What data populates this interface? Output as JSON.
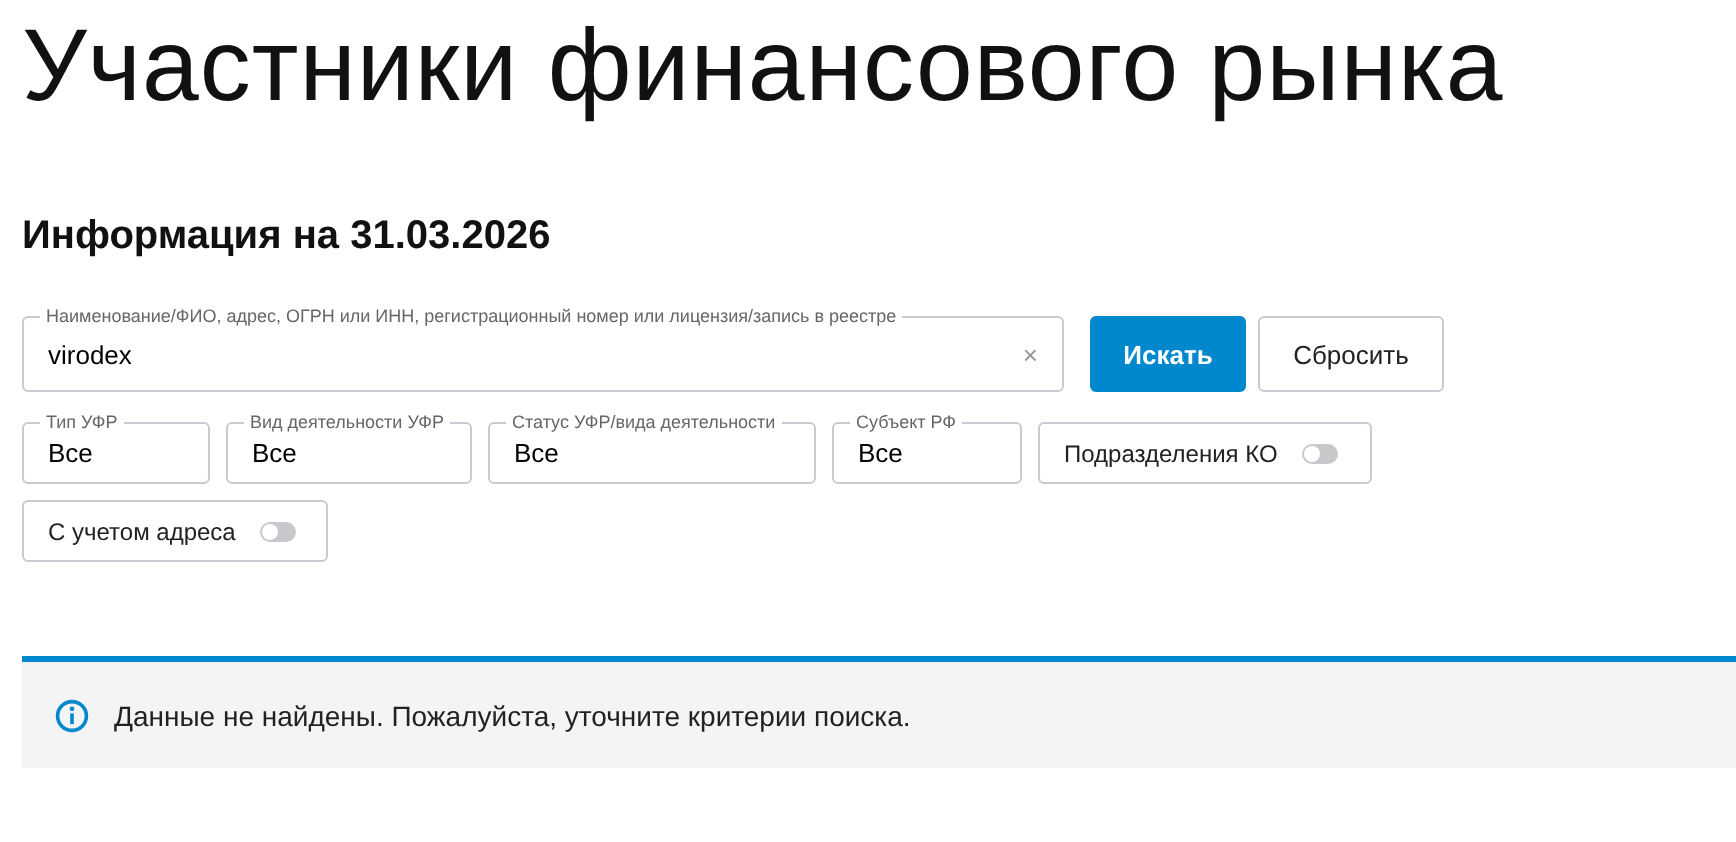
{
  "title": "Участники финансового рынка",
  "subtitle": "Информация на 31.03.2026",
  "search": {
    "label": "Наименование/ФИО, адрес, ОГРН или ИНН, регистрационный номер или лицензия/запись в реестре",
    "value": "virodex",
    "clear": "×"
  },
  "buttons": [
    {
      "label": "Искать",
      "kind": "primary"
    },
    {
      "label": "Сбросить",
      "kind": "secondary"
    }
  ],
  "filters": [
    {
      "kind": "select",
      "label": "Тип УФР",
      "value": "Все"
    },
    {
      "kind": "select",
      "label": "Вид деятельности УФР",
      "value": "Все"
    },
    {
      "kind": "select",
      "label": "Статус УФР/вида деятельности",
      "value": "Все"
    },
    {
      "kind": "select",
      "label": "Субъект РФ",
      "value": "Все"
    },
    {
      "kind": "toggle",
      "label": "Подразделения КО",
      "on": false
    },
    {
      "kind": "toggle",
      "label": "С учетом адреса",
      "on": false
    }
  ],
  "message": "Данные не найдены. Пожалуйста, уточните критерии поиска."
}
